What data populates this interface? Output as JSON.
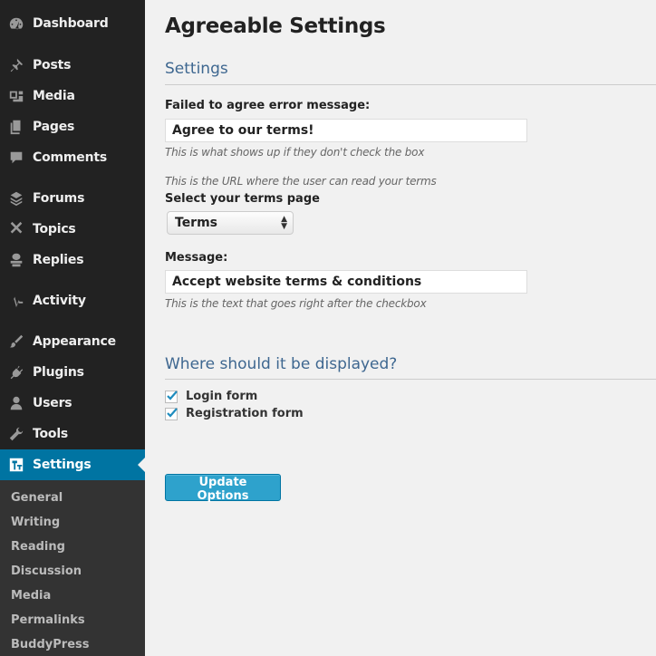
{
  "sidebar": {
    "items": [
      {
        "label": "Dashboard",
        "icon": "dashboard-icon"
      },
      {
        "label": "Posts",
        "icon": "pin-icon"
      },
      {
        "label": "Media",
        "icon": "media-icon"
      },
      {
        "label": "Pages",
        "icon": "pages-icon"
      },
      {
        "label": "Comments",
        "icon": "comment-icon"
      },
      {
        "label": "Forums",
        "icon": "forums-icon"
      },
      {
        "label": "Topics",
        "icon": "topics-icon"
      },
      {
        "label": "Replies",
        "icon": "replies-icon"
      },
      {
        "label": "Activity",
        "icon": "activity-icon"
      },
      {
        "label": "Appearance",
        "icon": "brush-icon"
      },
      {
        "label": "Plugins",
        "icon": "plug-icon"
      },
      {
        "label": "Users",
        "icon": "user-icon"
      },
      {
        "label": "Tools",
        "icon": "wrench-icon"
      },
      {
        "label": "Settings",
        "icon": "settings-icon"
      }
    ],
    "submenu": [
      "General",
      "Writing",
      "Reading",
      "Discussion",
      "Media",
      "Permalinks",
      "BuddyPress"
    ]
  },
  "page": {
    "title": "Agreeable Settings",
    "settings_heading": "Settings",
    "error_label": "Failed to agree error message:",
    "error_value": "Agree to our terms!",
    "error_desc": "This is what shows up if they don't check the box",
    "url_desc": "This is the URL where the user can read your terms",
    "terms_label": "Select your terms page",
    "terms_value": "Terms",
    "message_label": "Message:",
    "message_value": "Accept website terms & conditions",
    "message_desc": "This is the text that goes right after the checkbox",
    "display_heading": "Where should it be displayed?",
    "login_label": "Login form",
    "registration_label": "Registration form",
    "update_button": "Update Options"
  },
  "colors": {
    "sidebar_bg": "#222222",
    "active_bg": "#0074a2",
    "button_bg": "#2ea2cc",
    "heading_blue": "#3e6790"
  }
}
